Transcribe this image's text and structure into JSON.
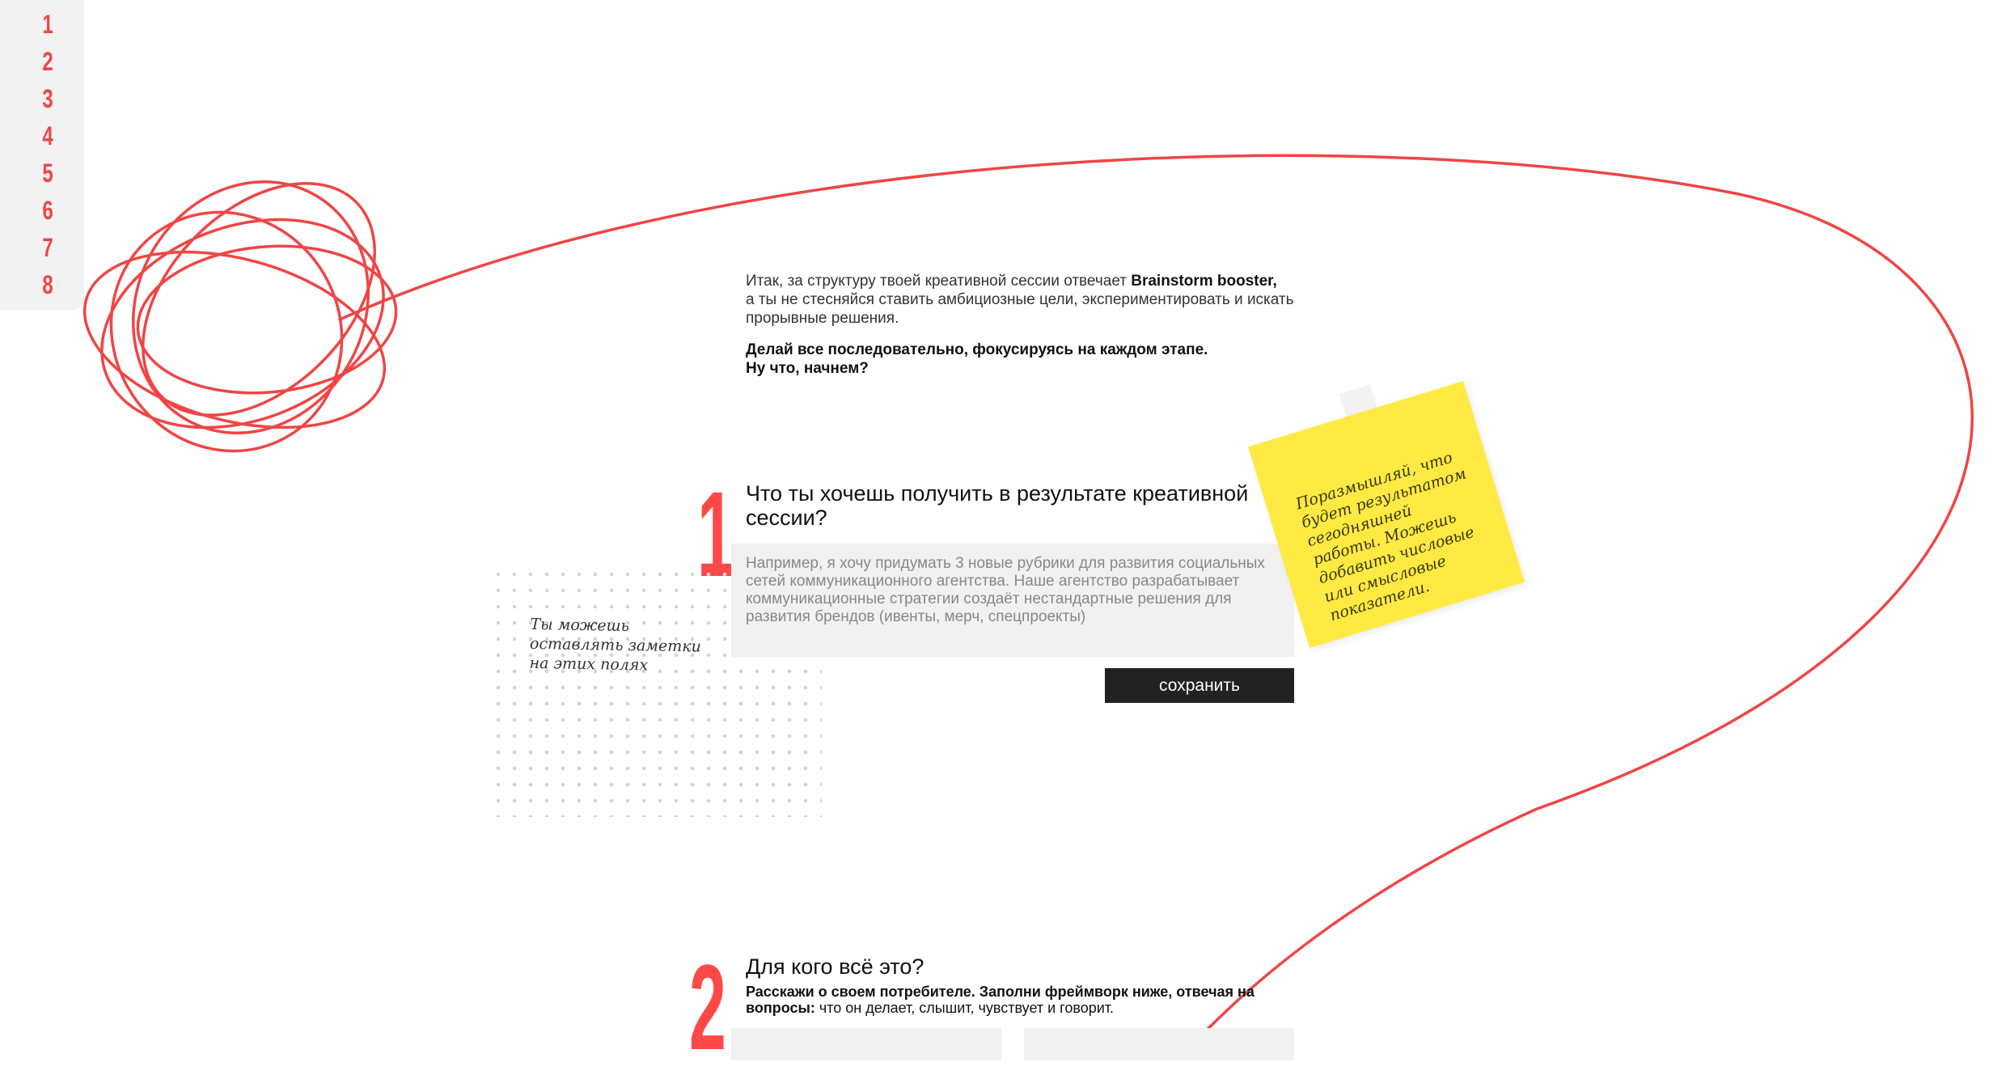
{
  "nav": {
    "items": [
      "1",
      "2",
      "3",
      "4",
      "5",
      "6",
      "7",
      "8"
    ]
  },
  "intro": {
    "line1_pre": "Итак, за структуру твоей креативной сессии отвечает ",
    "line1_brand": "Brainstorm booster,",
    "line1_post": "а ты не стесняйся ставить амбициозные цели, экспериментировать и искать прорывные решения.",
    "cta1": "Делай все последовательно, фокусируясь на каждом этапе.",
    "cta2": "Ну что, начнем?"
  },
  "step1": {
    "number": "1",
    "title": "Что ты хочешь получить в результате креативной сессии?",
    "placeholder": "Например, я хочу придумать 3 новые рубрики для развития социальных сетей коммуникационного агентства. Наше агентство разрабатывает коммуникационные стратегии создаёт нестандартные решения для развития брендов (ивенты, мерч, спецпроекты)",
    "save_label": "сохранить"
  },
  "notes_hint": "Ты можешь оставлять заметки на этих полях",
  "sticky": "Поразмышляй, что будет результатом сегодняшней работы. Можешь добавить числовые или смысловые показатели.",
  "step2": {
    "number": "2",
    "title": "Для кого всё это?",
    "subtitle_bold": "Расскажи о своем потребителе. Заполни фреймворк ниже, отвечая на вопросы:",
    "subtitle_rest": " что он делает, слышит, чувствует и говорит."
  },
  "colors": {
    "accent": "#ff4848",
    "sticky": "#ffea44",
    "button": "#222222"
  }
}
